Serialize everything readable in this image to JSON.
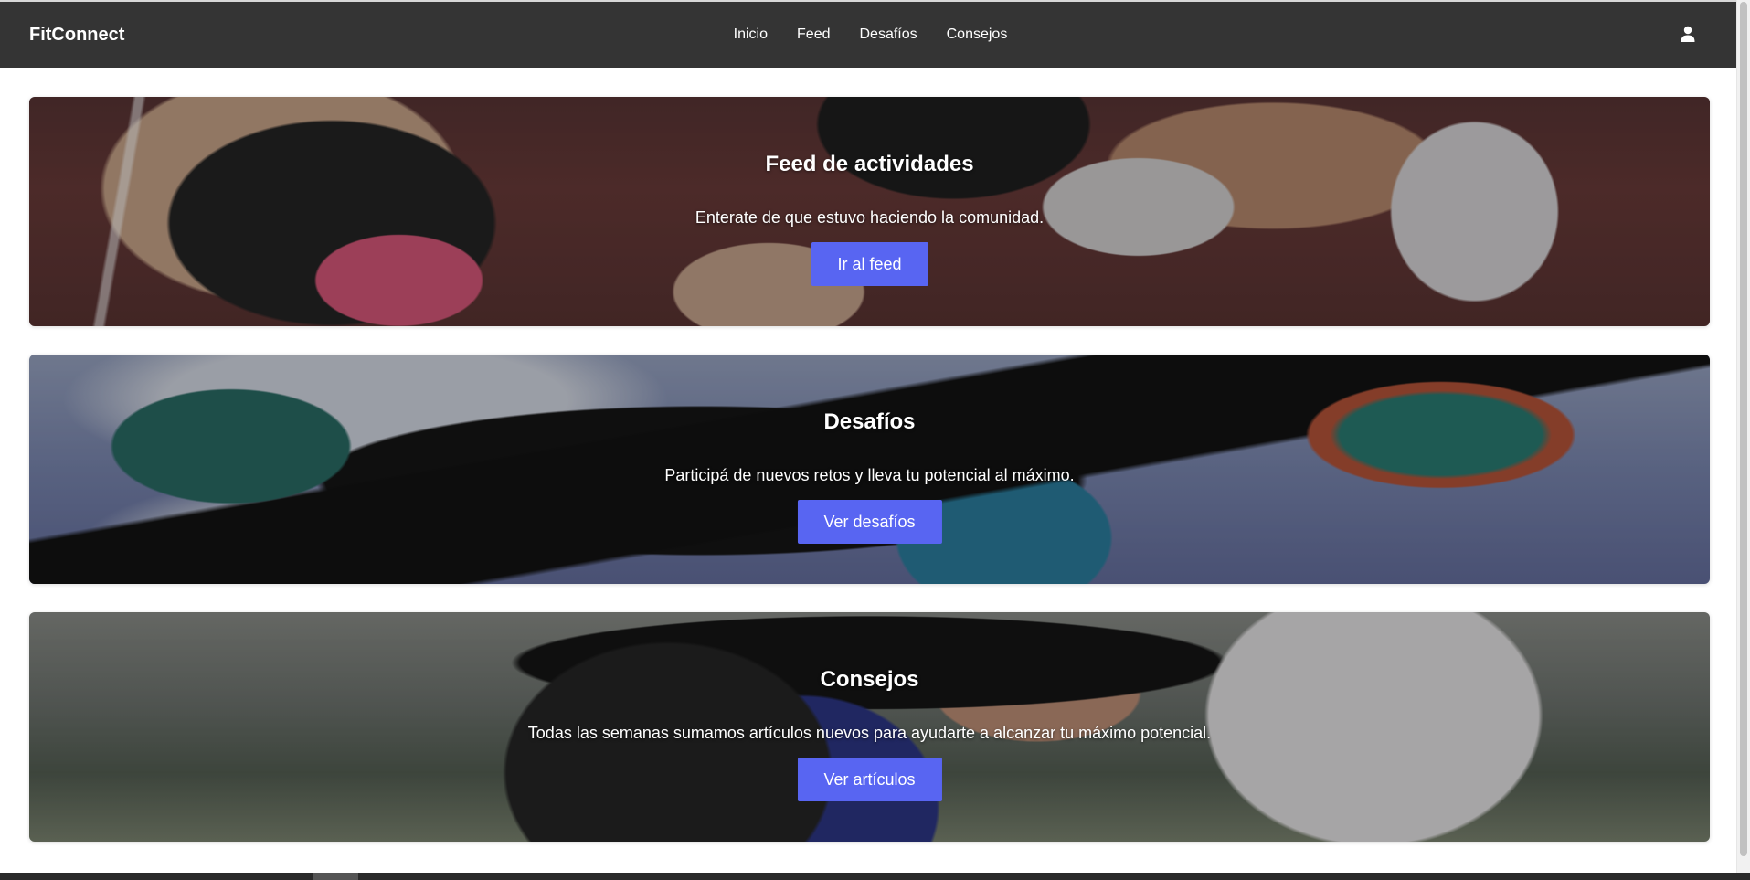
{
  "navbar": {
    "brand": "FitConnect",
    "links": [
      {
        "label": "Inicio"
      },
      {
        "label": "Feed"
      },
      {
        "label": "Desafíos"
      },
      {
        "label": "Consejos"
      }
    ],
    "user_icon": "user-icon"
  },
  "cards": [
    {
      "title": "Feed de actividades",
      "text": "Enterate de que estuvo haciendo la comunidad.",
      "button": "Ir al feed"
    },
    {
      "title": "Desafíos",
      "text": "Participá de nuevos retos y lleva tu potencial al máximo.",
      "button": "Ver desafíos"
    },
    {
      "title": "Consejos",
      "text": "Todas las semanas sumamos artículos nuevos para ayudarte a alcanzar tu máximo potencial.",
      "button": "Ver artículos"
    }
  ],
  "colors": {
    "navbar_bg": "#343434",
    "accent": "#5865f2"
  }
}
